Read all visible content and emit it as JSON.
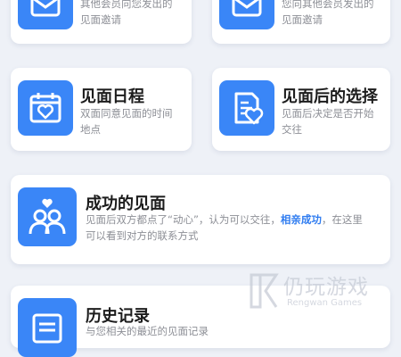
{
  "cards": {
    "received": {
      "line1": "其他会员向您发出的",
      "line2": "见面邀请"
    },
    "sent": {
      "line1": "您向其他会员发出的",
      "line2": "见面邀请"
    },
    "schedule": {
      "title": "见面日程",
      "line1": "双面同意见面的时间",
      "line2": "地点"
    },
    "after": {
      "title": "见面后的选择",
      "line1": "见面后决定是否开始",
      "line2": "交往"
    },
    "success": {
      "title": "成功的见面",
      "desc_a": "见面后双方都点了“动心”，认为可以交往，",
      "desc_highlight": "相亲成功",
      "desc_b": "，在这里",
      "line2": "可以看到对方的联系方式"
    },
    "history": {
      "title": "历史记录",
      "desc_partial": "与您相关的最近的见面记录"
    }
  },
  "watermark": {
    "name": "仍玩游戏",
    "sub": "Rengwan Games"
  },
  "colors": {
    "accent": "#3a86f7",
    "highlight": "#2f7cf0",
    "background": "#eef1f7"
  }
}
